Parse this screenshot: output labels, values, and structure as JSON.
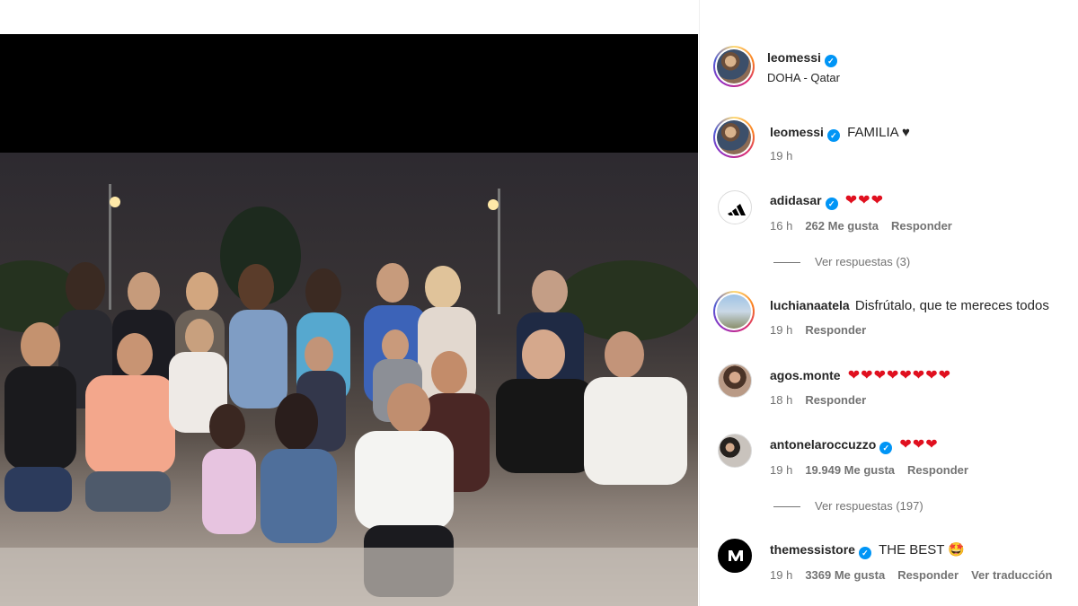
{
  "post": {
    "author": "leomessi",
    "location": "DOHA - Qatar",
    "caption_user": "leomessi",
    "caption_text": "FAMILIA ♥",
    "caption_time": "19 h"
  },
  "comments": [
    {
      "user": "adidasar",
      "verified": true,
      "text": "",
      "hearts": "❤❤❤",
      "time": "16 h",
      "likes": "262 Me gusta",
      "reply": "Responder",
      "view_replies": "Ver respuestas (3)"
    },
    {
      "user": "luchianaatela",
      "verified": false,
      "text": "Disfrútalo, que te mereces todos",
      "hearts": "",
      "time": "19 h",
      "likes": "",
      "reply": "Responder"
    },
    {
      "user": "agos.monte",
      "verified": false,
      "text": "",
      "hearts": "❤❤❤❤❤❤❤❤",
      "time": "18 h",
      "likes": "",
      "reply": "Responder"
    },
    {
      "user": "antonelaroccuzzo",
      "verified": true,
      "text": "",
      "hearts": "❤❤❤",
      "time": "19 h",
      "likes": "19.949 Me gusta",
      "reply": "Responder",
      "view_replies": "Ver respuestas (197)"
    },
    {
      "user": "themessistore",
      "verified": true,
      "text": "THE BEST 🤩",
      "hearts": "",
      "time": "19 h",
      "likes": "3369 Me gusta",
      "reply": "Responder",
      "translate": "Ver traducción"
    }
  ],
  "icons": {
    "verified": "verified-badge-icon",
    "adidas": "adidas-logo-icon",
    "messi_store": "messi-store-logo-icon"
  },
  "colors": {
    "verified": "#0095f6",
    "heart": "#e0101f",
    "meta_text": "#737373"
  }
}
